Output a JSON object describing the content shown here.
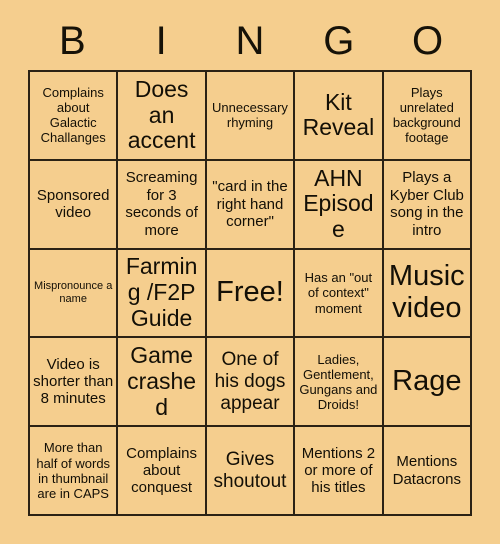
{
  "card": {
    "background_color": "#f5ce8e",
    "text_color": "#130f06",
    "border_color": "#2b2214",
    "header": {
      "letters": [
        "B",
        "I",
        "N",
        "G",
        "O"
      ]
    },
    "free_space": "Free!",
    "rows": [
      [
        {
          "text": "Complains about Galactic Challanges",
          "size": "sm"
        },
        {
          "text": "Does an accent",
          "size": "xl"
        },
        {
          "text": "Unnecessary rhyming",
          "size": "sm"
        },
        {
          "text": "Kit Reveal",
          "size": "xl"
        },
        {
          "text": "Plays unrelated background footage",
          "size": "sm"
        }
      ],
      [
        {
          "text": "Sponsored video",
          "size": "md"
        },
        {
          "text": "Screaming for 3 seconds of more",
          "size": "md"
        },
        {
          "text": "\"card in the right hand corner\"",
          "size": "md"
        },
        {
          "text": "AHN Episode",
          "size": "xl"
        },
        {
          "text": "Plays a Kyber Club song in the intro",
          "size": "md"
        }
      ],
      [
        {
          "text": "Mispronounce a name",
          "size": "xs"
        },
        {
          "text": "Farming /F2P Guide",
          "size": "xl"
        },
        {
          "text": "Free!",
          "size": "xxl"
        },
        {
          "text": "Has an \"out of context\" moment",
          "size": "sm"
        },
        {
          "text": "Music video",
          "size": "xxl"
        }
      ],
      [
        {
          "text": "Video is shorter than 8 minutes",
          "size": "md"
        },
        {
          "text": "Game crashed",
          "size": "xl"
        },
        {
          "text": "One of his dogs appear",
          "size": "lg"
        },
        {
          "text": "Ladies, Gentlement, Gungans and Droids!",
          "size": "sm"
        },
        {
          "text": "Rage",
          "size": "xxl"
        }
      ],
      [
        {
          "text": "More than half of words in thumbnail are in CAPS",
          "size": "sm"
        },
        {
          "text": "Complains about conquest",
          "size": "md"
        },
        {
          "text": "Gives shoutout",
          "size": "lg"
        },
        {
          "text": "Mentions 2 or more of his titles",
          "size": "md"
        },
        {
          "text": "Mentions Datacrons",
          "size": "md"
        }
      ]
    ]
  }
}
